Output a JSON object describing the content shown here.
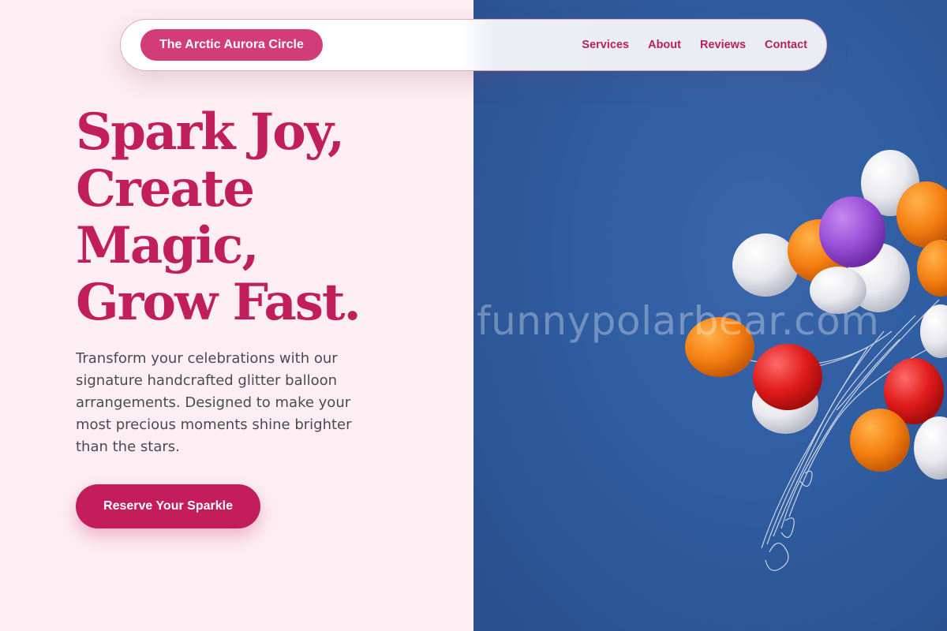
{
  "nav": {
    "brand": "The Arctic Aurora Circle",
    "links": [
      "Services",
      "About",
      "Reviews",
      "Contact"
    ]
  },
  "hero": {
    "headline_lines": [
      "Spark Joy,",
      "Create",
      "Magic,",
      "Grow Fast."
    ],
    "description": "Transform your celebrations with our signature handcrafted glitter balloon arrangements. Designed to make your most precious moments shine brighter than the stars.",
    "cta_label": "Reserve Your Sparkle"
  },
  "image": {
    "watermark": "funnypolarbear.com",
    "subject": "balloon-bunch-photo"
  },
  "colors": {
    "brand_pink": "#d23c78",
    "accent_magenta": "#c41d5c",
    "left_bg": "#fdeef3",
    "sky_blue": "#2f5da1"
  }
}
